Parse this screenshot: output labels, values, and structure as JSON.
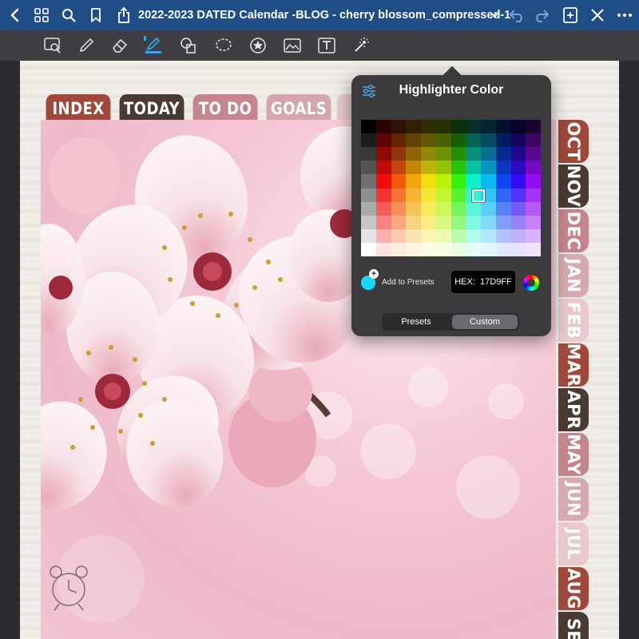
{
  "topbar": {
    "title": "2022-2023 DATED Calendar -BLOG - cherry blossom_compressed-1",
    "icons": [
      "back-icon",
      "grid-icon",
      "search-icon",
      "bookmark-icon",
      "share-icon",
      "chevron-down-icon",
      "undo-icon",
      "redo-icon",
      "add-page-icon",
      "close-icon",
      "more-icon"
    ]
  },
  "toolbar": {
    "tools": [
      "zoom-box-icon",
      "pen-icon",
      "eraser-icon",
      "highlighter-icon",
      "shapes-icon",
      "lasso-icon",
      "sticker-icon",
      "image-icon",
      "text-icon",
      "laser-pointer-icon"
    ],
    "colors": [
      "#a6a21a",
      "#1fa23a",
      "#17D9FF"
    ],
    "sizes": [
      "small",
      "medium",
      "large"
    ]
  },
  "tabs": [
    {
      "label": "INDEX",
      "color": "#a0483a"
    },
    {
      "label": "TODAY",
      "color": "#4a3a34"
    },
    {
      "label": "TO DO",
      "color": "#c5858f"
    },
    {
      "label": "GOALS",
      "color": "#d4a5ad"
    }
  ],
  "months": [
    {
      "label": "OCT",
      "color": "#a0483a"
    },
    {
      "label": "NOV",
      "color": "#4a3a34"
    },
    {
      "label": "DEC",
      "color": "#c5858f"
    },
    {
      "label": "JAN",
      "color": "#d7aab1"
    },
    {
      "label": "FEB",
      "color": "#e9c9cd"
    },
    {
      "label": "MAR",
      "color": "#a0483a"
    },
    {
      "label": "APR",
      "color": "#4a3a34"
    },
    {
      "label": "MAY",
      "color": "#c5858f"
    },
    {
      "label": "JUN",
      "color": "#d7aab1"
    },
    {
      "label": "JUL",
      "color": "#e9c9cd"
    },
    {
      "label": "AUG",
      "color": "#a0483a"
    },
    {
      "label": "SEP",
      "color": "#4a3a34"
    }
  ],
  "popover": {
    "title": "Highlighter Color",
    "settings_icon": "sliders-icon",
    "add_to_presets": "Add to Presets",
    "hex_label": "HEX:",
    "hex_value": "17D9FF",
    "current_color": "#17D9FF",
    "tabs": [
      "Presets",
      "Custom"
    ],
    "active_tab": "Custom"
  },
  "decor": {
    "clock_icon": "alarm-clock-icon"
  }
}
